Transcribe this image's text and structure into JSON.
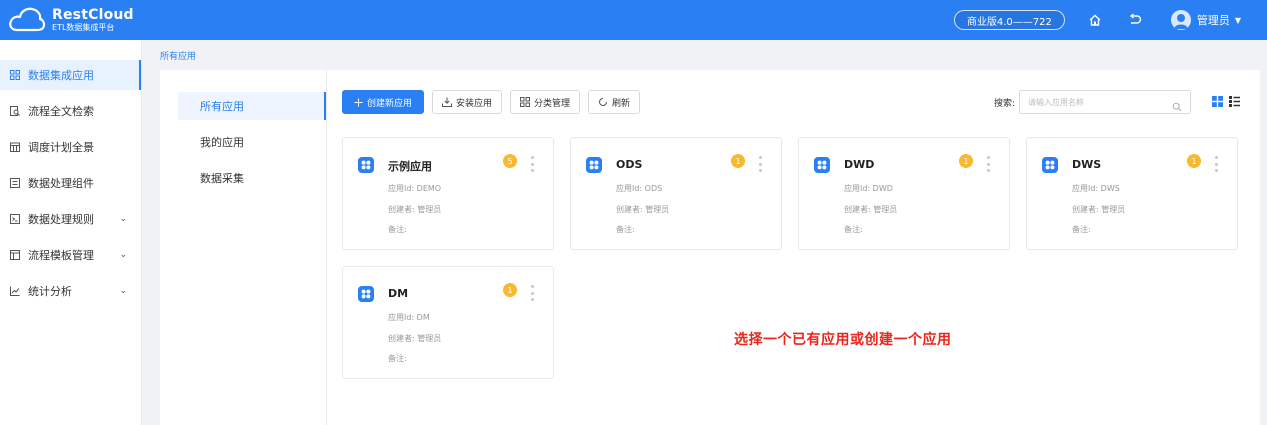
{
  "header": {
    "logo_name": "RestCloud",
    "logo_sub": "ETL数据集成平台",
    "version": "商业版4.0——722",
    "user": "管理员"
  },
  "sidebar": {
    "items": [
      {
        "label": "数据集成应用",
        "icon": "grid-icon",
        "active": true,
        "expandable": false
      },
      {
        "label": "流程全文检索",
        "icon": "search-doc-icon",
        "active": false,
        "expandable": false
      },
      {
        "label": "调度计划全景",
        "icon": "calendar-icon",
        "active": false,
        "expandable": false
      },
      {
        "label": "数据处理组件",
        "icon": "list-icon",
        "active": false,
        "expandable": false
      },
      {
        "label": "数据处理规则",
        "icon": "terminal-icon",
        "active": false,
        "expandable": true
      },
      {
        "label": "流程模板管理",
        "icon": "template-icon",
        "active": false,
        "expandable": true
      },
      {
        "label": "统计分析",
        "icon": "chart-icon",
        "active": false,
        "expandable": true
      }
    ]
  },
  "breadcrumb": "所有应用",
  "subnav": {
    "items": [
      {
        "label": "所有应用",
        "active": true
      },
      {
        "label": "我的应用",
        "active": false
      },
      {
        "label": "数据采集",
        "active": false
      }
    ]
  },
  "toolbar": {
    "create": "创建新应用",
    "install": "安装应用",
    "category": "分类管理",
    "refresh": "刷新"
  },
  "search": {
    "label": "搜索:",
    "placeholder": "请输入应用名称"
  },
  "cards": [
    {
      "title": "示例应用",
      "badge": "5",
      "id_line": "应用Id: DEMO",
      "creator_line": "创建者: 管理员",
      "note_line": "备注:"
    },
    {
      "title": "ODS",
      "badge": "1",
      "id_line": "应用Id: ODS",
      "creator_line": "创建者: 管理员",
      "note_line": "备注:"
    },
    {
      "title": "DWD",
      "badge": "1",
      "id_line": "应用Id: DWD",
      "creator_line": "创建者: 管理员",
      "note_line": "备注:"
    },
    {
      "title": "DWS",
      "badge": "1",
      "id_line": "应用Id: DWS",
      "creator_line": "创建者: 管理员",
      "note_line": "备注:"
    },
    {
      "title": "DM",
      "badge": "1",
      "id_line": "应用Id: DM",
      "creator_line": "创建者: 管理员",
      "note_line": "备注:"
    }
  ],
  "hint": "选择一个已有应用或创建一个应用",
  "colors": {
    "primary": "#2a7ff3",
    "badge": "#f9b82e",
    "hint": "#e8261c"
  }
}
